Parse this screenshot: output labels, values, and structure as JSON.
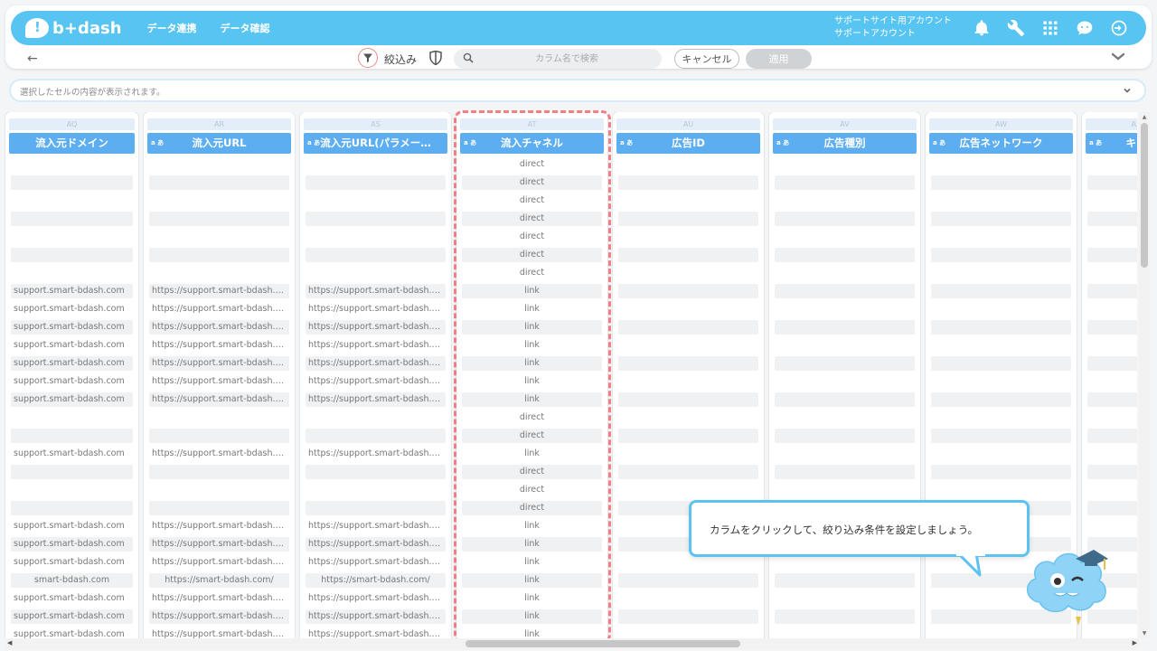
{
  "header": {
    "logo": "b+dash",
    "nav": [
      "データ連携",
      "データ確認"
    ],
    "account_line1": "サポートサイト用アカウント",
    "account_line2": "サポートアカウント",
    "icons": [
      "bell-icon",
      "wrench-icon",
      "grid-apps-icon",
      "chat-face-icon",
      "logout-icon"
    ]
  },
  "toolbar": {
    "back": "←",
    "filter_label": "絞込み",
    "search_placeholder": "カラム名で検索",
    "cancel_label": "キャンセル",
    "apply_label": "適用"
  },
  "cell_preview": {
    "placeholder": "選択したセルの内容が表示されます。"
  },
  "columns": [
    {
      "letter": "AQ",
      "type": "",
      "title": "流入元ドメイン"
    },
    {
      "letter": "AR",
      "type": "a あ",
      "title": "流入元URL"
    },
    {
      "letter": "AS",
      "type": "a あ",
      "title": "流入元URL(パラメー…"
    },
    {
      "letter": "AT",
      "type": "a あ",
      "title": "流入チャネル"
    },
    {
      "letter": "AU",
      "type": "a あ",
      "title": "広告ID"
    },
    {
      "letter": "AV",
      "type": "a あ",
      "title": "広告種別"
    },
    {
      "letter": "AW",
      "type": "a あ",
      "title": "広告ネットワーク"
    },
    {
      "letter": "AX",
      "type": "a あ",
      "title": "キャ"
    }
  ],
  "rows": [
    [
      "",
      "",
      "",
      "direct"
    ],
    [
      "",
      "",
      "",
      "direct"
    ],
    [
      "",
      "",
      "",
      "direct"
    ],
    [
      "",
      "",
      "",
      "direct"
    ],
    [
      "",
      "",
      "",
      "direct"
    ],
    [
      "",
      "",
      "",
      "direct"
    ],
    [
      "",
      "",
      "",
      "direct"
    ],
    [
      "support.smart-bdash.com",
      "https://support.smart-bdash.com/",
      "https://support.smart-bdash.com/",
      "link"
    ],
    [
      "support.smart-bdash.com",
      "https://support.smart-bdash.com/",
      "https://support.smart-bdash.com/",
      "link"
    ],
    [
      "support.smart-bdash.com",
      "https://support.smart-bdash.com/",
      "https://support.smart-bdash.com/",
      "link"
    ],
    [
      "support.smart-bdash.com",
      "https://support.smart-bdash.com/",
      "https://support.smart-bdash.com/",
      "link"
    ],
    [
      "support.smart-bdash.com",
      "https://support.smart-bdash.com/",
      "https://support.smart-bdash.com/",
      "link"
    ],
    [
      "support.smart-bdash.com",
      "https://support.smart-bdash.com/",
      "https://support.smart-bdash.com/",
      "link"
    ],
    [
      "support.smart-bdash.com",
      "https://support.smart-bdash.com/",
      "https://support.smart-bdash.com/",
      "link"
    ],
    [
      "",
      "",
      "",
      "direct"
    ],
    [
      "",
      "",
      "",
      "direct"
    ],
    [
      "support.smart-bdash.com",
      "https://support.smart-bdash.com/",
      "https://support.smart-bdash.com/",
      "link"
    ],
    [
      "",
      "",
      "",
      "direct"
    ],
    [
      "",
      "",
      "",
      "direct"
    ],
    [
      "",
      "",
      "",
      "direct"
    ],
    [
      "support.smart-bdash.com",
      "https://support.smart-bdash.com/",
      "https://support.smart-bdash.com/",
      "link"
    ],
    [
      "support.smart-bdash.com",
      "https://support.smart-bdash.com/",
      "https://support.smart-bdash.com/",
      "link"
    ],
    [
      "support.smart-bdash.com",
      "https://support.smart-bdash.com/",
      "https://support.smart-bdash.com/",
      "link"
    ],
    [
      "smart-bdash.com",
      "https://smart-bdash.com/",
      "https://smart-bdash.com/",
      "link"
    ],
    [
      "support.smart-bdash.com",
      "https://support.smart-bdash.com/",
      "https://support.smart-bdash.com/",
      "link"
    ],
    [
      "support.smart-bdash.com",
      "https://support.smart-bdash.com/",
      "https://support.smart-bdash.com/",
      "link"
    ],
    [
      "support.smart-bdash.com",
      "https://support.smart-bdash.com/",
      "https://support.smart-bdash.com/",
      "link"
    ]
  ],
  "tooltip": {
    "text": "カラムをクリックして、絞り込み条件を設定しましょう。"
  },
  "colors": {
    "brand": "#57c4f2",
    "header": "#5daef0",
    "highlight": "#f07f86"
  }
}
